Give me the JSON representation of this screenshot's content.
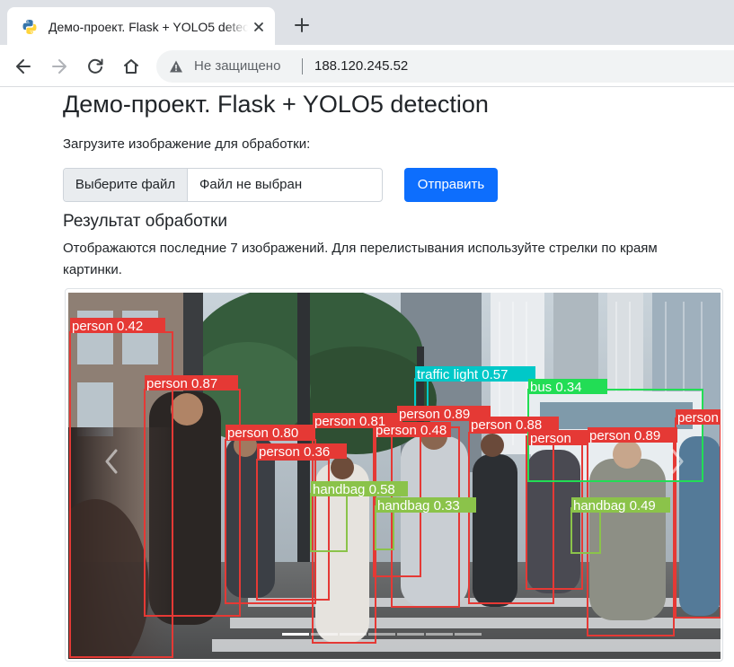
{
  "browser": {
    "tab_title": "Демо-проект. Flask + YOLO5 detection",
    "tab_close_icon": "close-icon",
    "new_tab_icon": "plus-icon",
    "security_label": "Не защищено",
    "url": "188.120.245.52"
  },
  "page": {
    "title": "Демо-проект. Flask + YOLO5 detection",
    "upload_label": "Загрузите изображение для обработки:",
    "file_button": "Выберите файл",
    "file_status": "Файл не выбран",
    "submit_label": "Отправить",
    "result_heading": "Результат обработки",
    "result_description": "Отображаются последние 7 изображений. Для перелистывания используйте стрелки по краям картинки."
  },
  "carousel": {
    "slide_count": 7,
    "active_index": 0,
    "prev_icon": "chevron-left-icon",
    "next_icon": "chevron-right-icon"
  },
  "detections": [
    {
      "label": "person 0.42",
      "color": "#e53935"
    },
    {
      "label": "person 0.87",
      "color": "#e53935"
    },
    {
      "label": "person 0.80",
      "color": "#e53935"
    },
    {
      "label": "person 0.36",
      "color": "#e53935"
    },
    {
      "label": "person 0.81",
      "color": "#e53935"
    },
    {
      "label": "person 0.89",
      "color": "#e53935"
    },
    {
      "label": "person 0.48",
      "color": "#e53935"
    },
    {
      "label": "person 0.88",
      "color": "#e53935"
    },
    {
      "label": "person 0.89",
      "color": "#e53935"
    },
    {
      "label": "person",
      "color": "#e53935"
    },
    {
      "label": "traffic light 0.57",
      "color": "#00c8c8"
    },
    {
      "label": "bus 0.34",
      "color": "#22dd55"
    },
    {
      "label": "handbag 0.58",
      "color": "#8bc34a"
    },
    {
      "label": "handbag 0.33",
      "color": "#8bc34a"
    },
    {
      "label": "handbag 0.49",
      "color": "#8bc34a"
    }
  ]
}
